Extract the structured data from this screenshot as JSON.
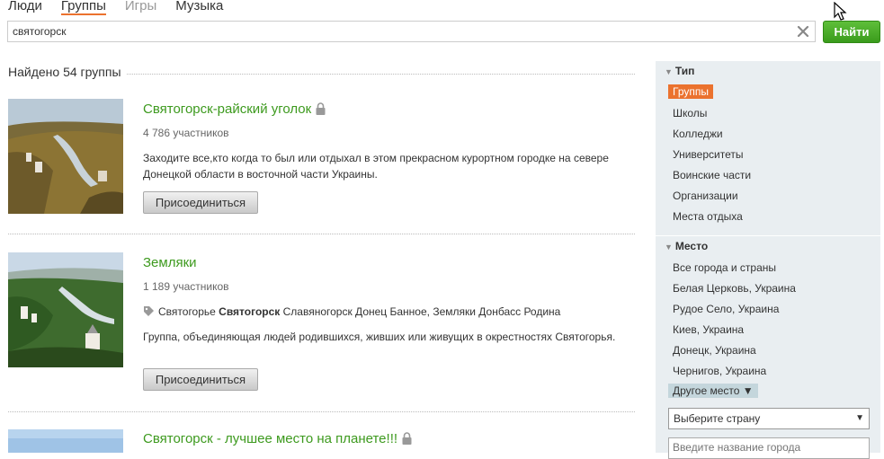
{
  "tabs": [
    "Люди",
    "Группы",
    "Игры",
    "Музыка"
  ],
  "search": {
    "value": "святогорск",
    "button": "Найти"
  },
  "found_label": "Найдено 54 группы",
  "groups": [
    {
      "title": "Святогорск-райский уголок",
      "members": "4 786 участников",
      "desc": "Заходите все,кто когда то был или отдыхал в этом прекрасном курортном городке на севере Донецкой области в восточной части Украины.",
      "join": "Присоединиться"
    },
    {
      "title": "Земляки",
      "members": "1 189 участников",
      "tags_pre": "Святогорье ",
      "tags_bold": "Святогорск",
      "tags_post": " Славяногорск Донец Банное,  Земляки Донбасс Родина",
      "desc": "Группа, объединяющая людей родившихся, живших или живущих  в окрестностях Святогорья.",
      "join": "Присоединиться"
    },
    {
      "title": "Святогорск - лучшее место на планете!!!"
    }
  ],
  "sidebar": {
    "type_header": "Тип",
    "types": [
      "Группы",
      "Школы",
      "Колледжи",
      "Университеты",
      "Воинские части",
      "Организации",
      "Места отдыха"
    ],
    "place_header": "Место",
    "places": [
      "Все города и страны",
      "Белая Церковь, Украина",
      "Рудое Село, Украина",
      "Киев, Украина",
      "Донецк, Украина",
      "Чернигов, Украина"
    ],
    "other_place": "Другое место ▼",
    "country_select": "Выберите страну",
    "city_placeholder": "Введите название города"
  }
}
